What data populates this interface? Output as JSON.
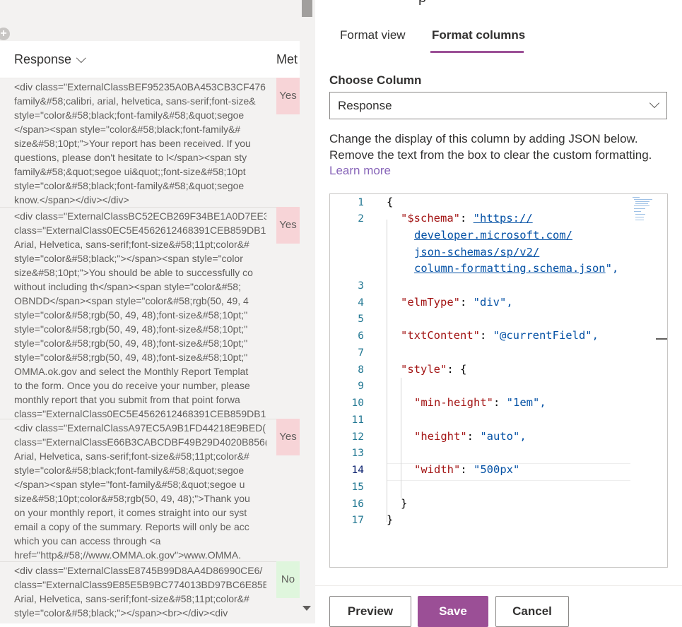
{
  "list": {
    "add_column_symbol": "+",
    "columns": {
      "response": "Response",
      "meta": "Met"
    },
    "rows": [
      {
        "lines": [
          "<div class=\"ExternalClassBEF95235A0BA453CB3CF476",
          "family&#58;calibri, arial, helvetica, sans-serif;font-size&",
          "style=\"color&#58;black;font-family&#58;&quot;segoe",
          "</span><span style=\"color&#58;black;font-family&#",
          "size&#58;10pt;\">Your report has been received. If you",
          "questions, please don't hesitate to l</span><span sty",
          "family&#58;&quot;segoe ui&quot;;font-size&#58;10pt",
          "style=\"color&#58;black;font-family&#58;&quot;segoe",
          "know.</span></div></div>"
        ],
        "badge": "Yes"
      },
      {
        "lines": [
          "<div class=\"ExternalClassBC52ECB269F34BE1A0D7EE3",
          "class=\"ExternalClass0EC5E4562612468391CEB859DB1",
          "Arial, Helvetica, sans-serif;font-size&#58;11pt;color&#",
          "style=\"color&#58;black;\"></span><span style=\"color",
          "size&#58;10pt;\">You should be able to successfully co",
          "without including th</span><span style=\"color&#58;",
          "OBNDD</span><span style=\"color&#58;rgb(50, 49, 4",
          "style=\"color&#58;rgb(50, 49, 48);font-size&#58;10pt;\"",
          "style=\"color&#58;rgb(50, 49, 48);font-size&#58;10pt;\"",
          "style=\"color&#58;rgb(50, 49, 48);font-size&#58;10pt;\"",
          "style=\"color&#58;rgb(50, 49, 48);font-size&#58;10pt;\"",
          "OMMA.ok.gov and select the Monthly Report Templat",
          "to the form. Once you do receive your number, please",
          "monthly report that you submit from that point forwa",
          "class=\"ExternalClass0EC5E4562612468391CEB859DB1"
        ],
        "badge": "Yes"
      },
      {
        "lines": [
          "<div class=\"ExternalClassA97EC5A9B1FD44218E9BED(",
          "class=\"ExternalClassE66B3CABCDBF49B29D4020B856(",
          "Arial, Helvetica, sans-serif;font-size&#58;11pt;color&#",
          "style=\"color&#58;black;font-family&#58;&quot;segoe",
          "</span><span style=\"font-family&#58;&quot;segoe u",
          "size&#58;10pt;color&#58;rgb(50, 49, 48);\">Thank you",
          "on your monthly report, it comes straight into our syst",
          "email a copy of the summary. Reports will only be acc",
          "which you can access through <a",
          "href=\"http&#58;//www.OMMA.ok.gov\">www.OMMA."
        ],
        "badge": "Yes"
      },
      {
        "lines": [
          "<div class=\"ExternalClassE8745B99D8AA4D86990CE6/",
          "class=\"ExternalClass9E85E5B9BC774013BD97BC6E85E",
          "Arial, Helvetica, sans-serif;font-size&#58;11pt;color&#",
          "style=\"color&#58;black;\"></span><br></div><div"
        ],
        "badge": "No"
      }
    ]
  },
  "format_pane": {
    "title_fragment": "p",
    "tabs": {
      "format_view": "Format view",
      "format_columns": "Format columns"
    },
    "choose_column_label": "Choose Column",
    "selected_column": "Response",
    "description": "Change the display of this column by adding JSON below. Remove the text from the box to clear the custom formatting.",
    "learn_more": "Learn more",
    "editor": {
      "line_numbers": [
        "1",
        "2",
        "",
        "",
        "",
        "3",
        "4",
        "5",
        "6",
        "7",
        "8",
        "9",
        "10",
        "11",
        "12",
        "13",
        "14",
        "15",
        "16",
        "17"
      ],
      "tokens": {
        "open_brace": "{",
        "schema_key": "\"$schema\"",
        "schema_url_1": "\"https://",
        "schema_url_2": "developer.microsoft.com/",
        "schema_url_3": "json-schemas/sp/v2/",
        "schema_url_4": "column-formatting.schema.json",
        "schema_url_end": "\",",
        "elm_key": "\"elmType\"",
        "elm_val": "\"div\",",
        "txt_key": "\"txtContent\"",
        "txt_val": "\"@currentField\",",
        "style_key": "\"style\"",
        "style_open": ": {",
        "minh_key": "\"min-height\"",
        "minh_val": "\"1em\",",
        "height_key": "\"height\"",
        "height_val": "\"auto\",",
        "width_key": "\"width\"",
        "width_val": "\"500px\"",
        "inner_close": "}",
        "outer_close": "}",
        "colon": ": "
      }
    },
    "buttons": {
      "preview": "Preview",
      "save": "Save",
      "cancel": "Cancel"
    },
    "colors": {
      "accent": "#9b4f96",
      "yes_badge": "#f7d4d7",
      "no_badge": "#dff6dd",
      "link": "#8764b8"
    }
  }
}
